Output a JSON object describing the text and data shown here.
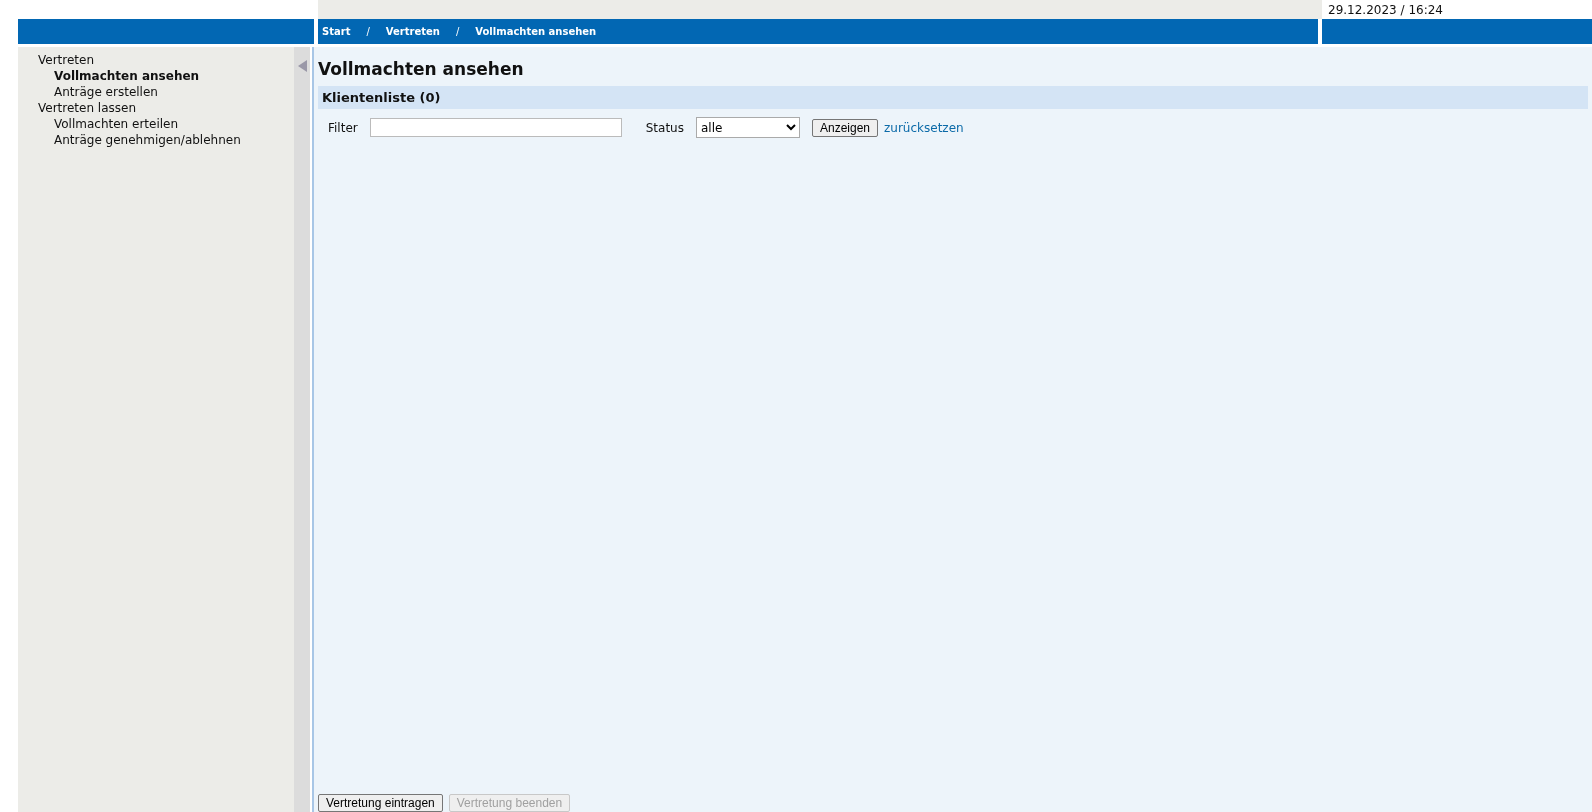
{
  "header": {
    "datetime": "29.12.2023 / 16:24"
  },
  "breadcrumb": [
    {
      "kind": "link",
      "label": "Start"
    },
    {
      "kind": "separator",
      "label": "/"
    },
    {
      "kind": "link",
      "label": "Vertreten"
    },
    {
      "kind": "separator",
      "label": "/"
    },
    {
      "kind": "link",
      "label": "Vollmachten ansehen"
    }
  ],
  "sidebar": {
    "items": [
      {
        "label": "Vertreten",
        "selected": false,
        "children": [
          {
            "label": "Vollmachten ansehen",
            "selected": true
          },
          {
            "label": "Anträge erstellen",
            "selected": false
          }
        ]
      },
      {
        "label": "Vertreten lassen",
        "selected": false,
        "children": [
          {
            "label": "Vollmachten erteilen",
            "selected": false
          },
          {
            "label": "Anträge genehmigen/ablehnen",
            "selected": false
          }
        ]
      }
    ]
  },
  "page": {
    "title": "Vollmachten ansehen",
    "section_title": "Klientenliste (0)",
    "filter": {
      "label": "Filter"
    },
    "status": {
      "label": "Status",
      "value": "alle"
    },
    "show_button": "Anzeigen",
    "reset_link": "zurücksetzen"
  },
  "buttons": [
    {
      "label": "Vertretung eintragen",
      "disabled": false
    },
    {
      "label": "Vertretung beenden",
      "disabled": true
    }
  ]
}
